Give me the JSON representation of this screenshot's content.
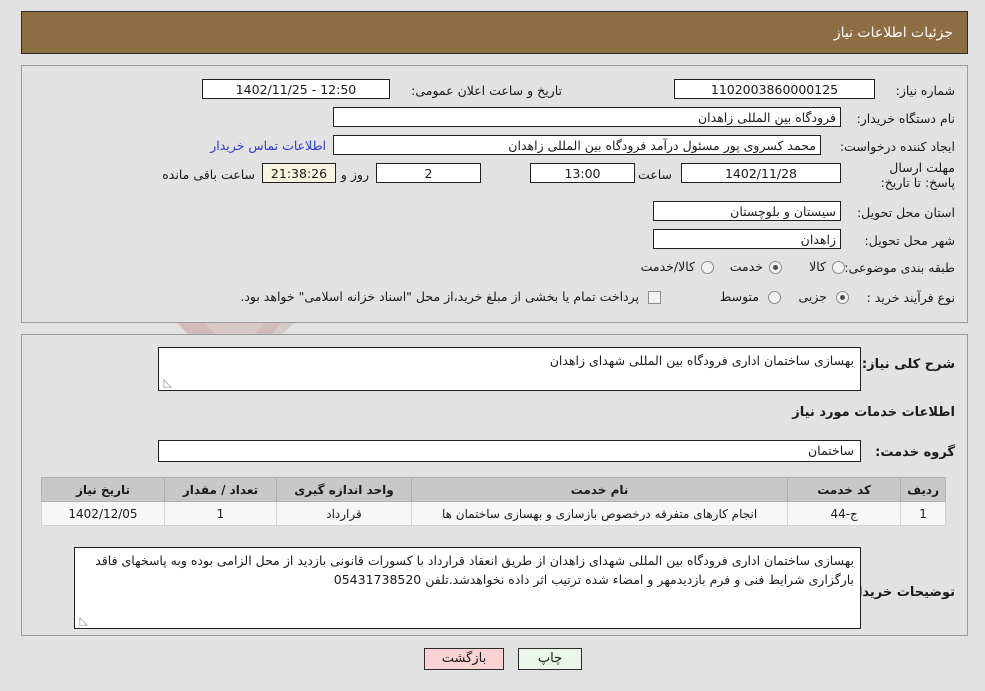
{
  "header": {
    "title": "جزئیات اطلاعات نیاز"
  },
  "top_panel": {
    "need_number_label": "شماره نیاز:",
    "need_number_value": "1102003860000125",
    "announce_label": "تاریخ و ساعت اعلان عمومی:",
    "announce_value": "12:50 - 1402/11/25",
    "buyer_org_label": "نام دستگاه خریدار:",
    "buyer_org_value": "فرودگاه بین المللی زاهدان",
    "creator_label": "ایجاد کننده درخواست:",
    "creator_value": "محمد کسروی پور مسئول درآمد فرودگاه بین المللی زاهدان",
    "contact_link": "اطلاعات تماس خریدار",
    "deadline_label": "مهلت ارسال پاسخ: تا تاریخ:",
    "deadline_date": "1402/11/28",
    "deadline_hour_label": "ساعت",
    "deadline_hour": "13:00",
    "days_left": "2",
    "days_left_label": "روز و",
    "time_left": "21:38:26",
    "time_left_label": "ساعت باقی مانده",
    "province_label": "استان محل تحویل:",
    "province_value": "سیستان و بلوچستان",
    "city_label": "شهر محل تحویل:",
    "city_value": "زاهدان",
    "category_label": "طبقه بندی موضوعی:",
    "category_options": [
      {
        "label": "کالا",
        "selected": false
      },
      {
        "label": "خدمت",
        "selected": true
      },
      {
        "label": "کالا/خدمت",
        "selected": false
      }
    ],
    "process_label": "نوع فرآیند خرید :",
    "process_options": [
      {
        "label": "جزیی",
        "selected": true
      },
      {
        "label": "متوسط",
        "selected": false
      }
    ],
    "treasury_checked": false,
    "treasury_note": "پرداخت تمام یا بخشی از مبلغ خرید،از محل \"اسناد خزانه اسلامی\" خواهد بود."
  },
  "bottom_panel": {
    "summary_label": "شرح کلی نیاز:",
    "summary_value": "بهسازی ساختمان اداری فرودگاه بین المللی شهدای زاهدان",
    "services_title": "اطلاعات خدمات مورد نیاز",
    "service_group_label": "گروه خدمت:",
    "service_group_value": "ساختمان",
    "table": {
      "columns": [
        "ردیف",
        "کد خدمت",
        "نام خدمت",
        "واحد اندازه گیری",
        "تعداد / مقدار",
        "تاریخ نیاز"
      ],
      "rows": [
        {
          "row": "1",
          "code": "ج-44",
          "name": "انجام کارهای متفرقه درخصوص بازسازی و بهسازی ساختمان ها",
          "unit": "قرارداد",
          "qty": "1",
          "need_date": "1402/12/05"
        }
      ]
    },
    "notes_label": "توضیحات خریدار:",
    "notes_value": "بهسازی ساختمان اداری فرودگاه بین المللی شهدای زاهدان از طریق انعقاد قرارداد با کسورات قانونی بازدید از محل الزامی بوده وبه پاسخهای فاقد بارگزاری شرایط فنی و فرم بازدیدمهر و امضاء شده ترتیب اثر داده نخواهدشد.تلفن 05431738520"
  },
  "footer": {
    "print_label": "چاپ",
    "back_label": "بازگشت"
  },
  "theme": {
    "header_brown": "#8d6e43",
    "page_bg": "#e2e2e2",
    "link_blue": "#2b3ad6",
    "table_header_gray": "#c8c8c8",
    "countdown_cream": "#f7f4e0",
    "print_green": "#e8f7e8",
    "back_pink": "#fbd3d3"
  }
}
